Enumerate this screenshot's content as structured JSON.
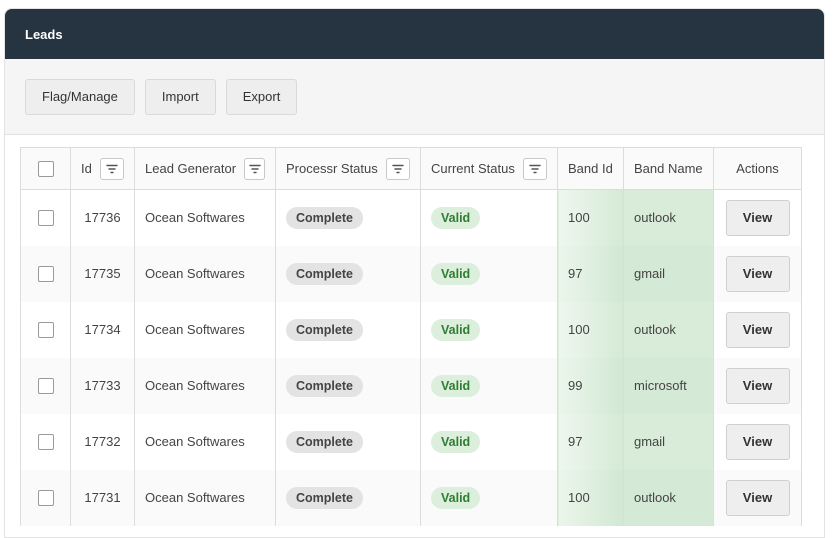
{
  "panel": {
    "title": "Leads"
  },
  "toolbar": {
    "flag_label": "Flag/Manage",
    "import_label": "Import",
    "export_label": "Export"
  },
  "table": {
    "headers": {
      "id": "Id",
      "lead_generator": "Lead Generator",
      "processor_status": "Processr Status",
      "current_status": "Current Status",
      "band_id": "Band Id",
      "band_name": "Band Name",
      "actions": "Actions"
    },
    "rows": [
      {
        "id": "17736",
        "lead_generator": "Ocean Softwares",
        "processor_status": "Complete",
        "current_status": "Valid",
        "band_id": "100",
        "band_name": "outlook",
        "action": "View"
      },
      {
        "id": "17735",
        "lead_generator": "Ocean Softwares",
        "processor_status": "Complete",
        "current_status": "Valid",
        "band_id": "97",
        "band_name": "gmail",
        "action": "View"
      },
      {
        "id": "17734",
        "lead_generator": "Ocean Softwares",
        "processor_status": "Complete",
        "current_status": "Valid",
        "band_id": "100",
        "band_name": "outlook",
        "action": "View"
      },
      {
        "id": "17733",
        "lead_generator": "Ocean Softwares",
        "processor_status": "Complete",
        "current_status": "Valid",
        "band_id": "99",
        "band_name": "microsoft",
        "action": "View"
      },
      {
        "id": "17732",
        "lead_generator": "Ocean Softwares",
        "processor_status": "Complete",
        "current_status": "Valid",
        "band_id": "97",
        "band_name": "gmail",
        "action": "View"
      },
      {
        "id": "17731",
        "lead_generator": "Ocean Softwares",
        "processor_status": "Complete",
        "current_status": "Valid",
        "band_id": "100",
        "band_name": "outlook",
        "action": "View"
      }
    ]
  },
  "icons": {
    "filter": "filter-lines-icon",
    "checkbox": "checkbox-icon"
  },
  "colors": {
    "header_bg": "#263340",
    "valid_chip_bg": "#dcefdc",
    "valid_chip_text": "#2e7d32",
    "complete_chip_bg": "#e3e3e3",
    "band_highlight": "#d8ecd9"
  }
}
